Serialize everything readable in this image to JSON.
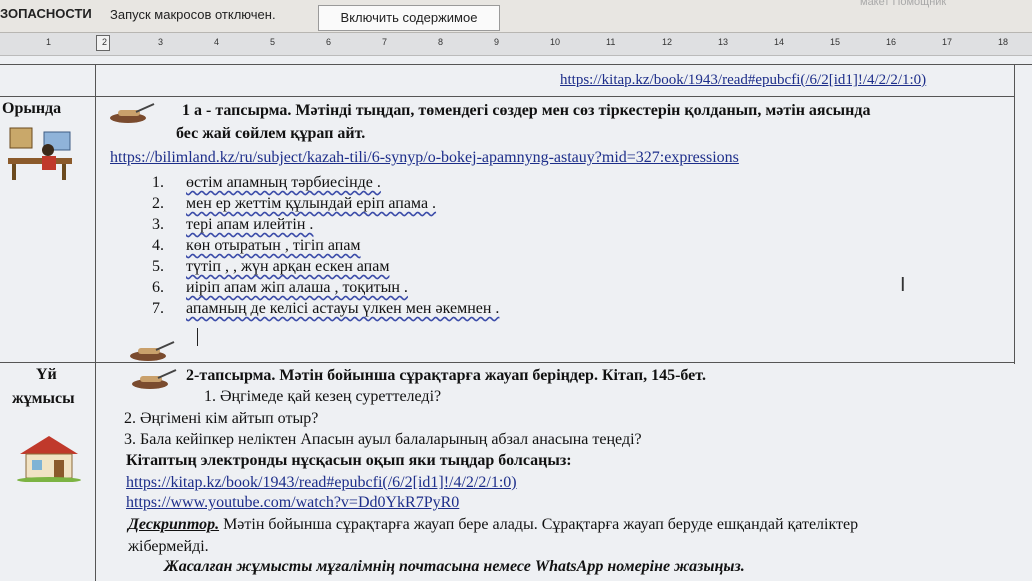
{
  "security_bar": {
    "label": "ЗОПАСНОСТИ",
    "message": "Запуск макросов отключен.",
    "enable_button": "Включить содержимое",
    "faded_right": "макет        Помощник"
  },
  "ruler": {
    "ticks": [
      "1",
      "2",
      "3",
      "4",
      "5",
      "6",
      "7",
      "8",
      "9",
      "10",
      "11",
      "12",
      "13",
      "14",
      "15",
      "16",
      "17",
      "18"
    ]
  },
  "top_url": "https://kitap.kz/book/1943/read#epubcfi(/6/2[id1]!/4/2/2/1:0)",
  "rows": {
    "classroom": {
      "label": "Орында",
      "task_title_line1": "1 а - тапсырма. Мәтінді тыңдап, төмендегі сөздер мен сөз тіркестерін қолданып, мәтін аясында",
      "task_title_line2": "бес жай сөйлем құрап айт.",
      "link": "https://bilimland.kz/ru/subject/kazah-tili/6-synyp/o-bokej-apamnyng-astauy?mid=327:expressions",
      "items": [
        {
          "num": "1.",
          "text": "өстім  апамның  тәрбиесінде ."
        },
        {
          "num": "2.",
          "text": "мен ер жеттім құлындай еріп апама ."
        },
        {
          "num": "3.",
          "text": "тері апам илейтін ."
        },
        {
          "num": "4.",
          "text": "көн отыратын , тігіп апам"
        },
        {
          "num": "5.",
          "text": "түтіп , , жүн арқан ескен апам"
        },
        {
          "num": "6.",
          "text": "иіріп апам жіп алаша , тоқитын ."
        },
        {
          "num": "7.",
          "text": "апамның де келісі астауы үлкен мен әкемнен ."
        }
      ]
    },
    "homework": {
      "label_line1": "Үй",
      "label_line2": "жұмысы",
      "task_title": "2-тапсырма. Мәтін бойынша сұрақтарға жауап беріңдер. Кітап, 145-бет.",
      "questions": [
        "1. Әңгімеде қай кезең суреттеледі?",
        "2. Әңгімені кім айтып отыр?",
        "3. Бала кейіпкер неліктен Апасын ауыл балаларының абзал анасына теңеді?"
      ],
      "ebook_note": "Кітаптың электронды нұсқасын оқып яки тыңдар болсаңыз:",
      "link1": "https://kitap.kz/book/1943/read#epubcfi(/6/2[id1]!/4/2/2/1:0)",
      "link2": "https://www.youtube.com/watch?v=Dd0YkR7PyR0",
      "descriptor_label": "Дескриптор.",
      "descriptor_text": "Мәтін бойынша сұрақтарға жауап бере алады. Сұрақтарға жауап беруде ешқандай қателіктер",
      "descriptor_cont": "жібермейді.",
      "send_note": "Жасалған жұмысты мұғалімнің почтасына  немесе   WhatsApp  номеріне жазыңыз."
    }
  }
}
